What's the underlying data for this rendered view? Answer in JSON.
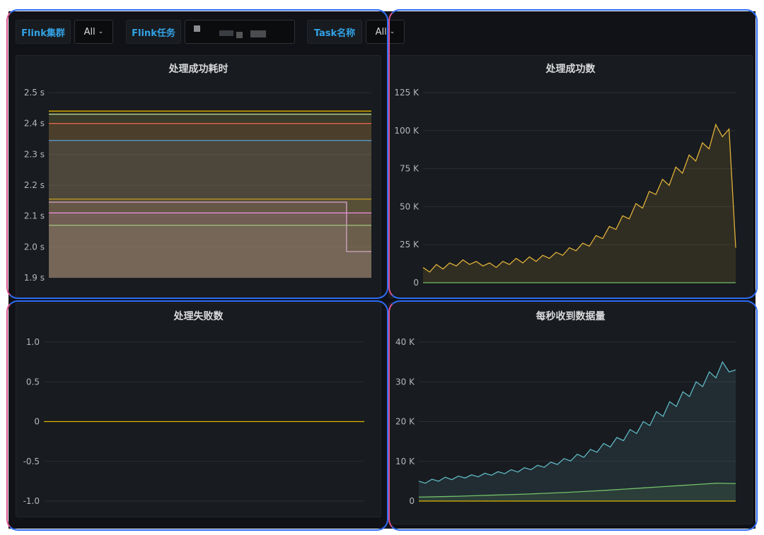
{
  "variables": [
    {
      "label": "Flink集群",
      "value": "All"
    },
    {
      "label": "Flink任务",
      "value": ""
    },
    {
      "label": "Task名称",
      "value": "All"
    }
  ],
  "panels": [
    {
      "title": "处理成功耗时",
      "chart_data": {
        "type": "area",
        "yticks": [
          "2.5 s",
          "2.4 s",
          "2.3 s",
          "2.2 s",
          "2.1 s",
          "2.0 s",
          "1.9 s"
        ],
        "ylim": [
          1.9,
          2.5
        ],
        "unit": "s",
        "series": [
          {
            "color": "#e0b400",
            "values": [
              2.44,
              2.44
            ]
          },
          {
            "color": "#b8d99a",
            "values": [
              2.43,
              2.43
            ]
          },
          {
            "color": "#e0654d",
            "values": [
              2.4,
              2.4
            ]
          },
          {
            "color": "#5794c6",
            "values": [
              2.345,
              2.345
            ]
          },
          {
            "color": "#c09a20",
            "values": [
              2.155,
              2.155
            ]
          },
          {
            "color": "#d9a5cf",
            "values": [
              2.145,
              2.145,
              2.145,
              2.145,
              2.145,
              2.145,
              2.145,
              2.145,
              2.145,
              2.145,
              2.145,
              2.145,
              2.145,
              2.145,
              2.145,
              2.145,
              2.145,
              2.145,
              2.145,
              2.145,
              2.145,
              2.145,
              2.145,
              2.145,
              2.145,
              2.145,
              2.145,
              2.145,
              2.145,
              2.145,
              2.145,
              2.145,
              2.145,
              2.145,
              2.145,
              2.145,
              1.985,
              1.985,
              1.985,
              1.985
            ]
          },
          {
            "color": "#e58ed4",
            "values": [
              2.11,
              2.11
            ]
          },
          {
            "color": "#9ec57a",
            "values": [
              2.07,
              2.07
            ]
          }
        ]
      }
    },
    {
      "title": "处理成功数",
      "chart_data": {
        "type": "area",
        "yticks": [
          "125 K",
          "100 K",
          "75 K",
          "50 K",
          "25 K",
          "0"
        ],
        "ylim": [
          0,
          125000
        ],
        "series": [
          {
            "color": "#e0b13a",
            "values": [
              10000,
              7000,
              12000,
              9000,
              13000,
              11000,
              15000,
              12000,
              14000,
              11000,
              13000,
              10000,
              14000,
              12000,
              16000,
              13000,
              17000,
              14000,
              18000,
              16000,
              20000,
              18000,
              23000,
              21000,
              26000,
              24000,
              31000,
              29000,
              37000,
              35000,
              44000,
              42000,
              52000,
              49000,
              60000,
              58000,
              68000,
              64000,
              76000,
              72000,
              84000,
              80000,
              92000,
              88000,
              104000,
              96000,
              101000,
              23000
            ]
          },
          {
            "color": "#73bf69",
            "values": [
              0,
              0
            ]
          }
        ]
      }
    },
    {
      "title": "处理失败数",
      "chart_data": {
        "type": "line",
        "yticks": [
          "1.0",
          "0.5",
          "0",
          "-0.5",
          "-1.0"
        ],
        "ylim": [
          -1,
          1
        ],
        "series": [
          {
            "color": "#e0b400",
            "values": [
              0,
              0
            ]
          }
        ]
      }
    },
    {
      "title": "每秒收到数据量",
      "chart_data": {
        "type": "area",
        "yticks": [
          "40 K",
          "30 K",
          "20 K",
          "10 K",
          "0"
        ],
        "ylim": [
          0,
          40000
        ],
        "series": [
          {
            "color": "#5fb8c4",
            "values": [
              5000,
              4500,
              5500,
              5000,
              6000,
              5400,
              6300,
              5800,
              6600,
              6100,
              7000,
              6500,
              7400,
              6900,
              7900,
              7300,
              8400,
              7900,
              9000,
              8500,
              9800,
              9200,
              10700,
              10100,
              11800,
              11000,
              13000,
              12300,
              14500,
              13600,
              16000,
              15200,
              18000,
              17000,
              20000,
              19000,
              22500,
              21300,
              25000,
              23800,
              27500,
              26300,
              30000,
              28800,
              32500,
              31000,
              35000,
              32500,
              33000
            ]
          },
          {
            "color": "#73bf69",
            "values": [
              1000,
              1100,
              1200,
              1350,
              1500,
              1650,
              1800,
              2000,
              2200,
              2450,
              2700,
              3000,
              3300,
              3600,
              3900,
              4200,
              4500,
              4400
            ]
          },
          {
            "color": "#e0b400",
            "values": [
              0,
              0
            ]
          }
        ]
      }
    }
  ]
}
